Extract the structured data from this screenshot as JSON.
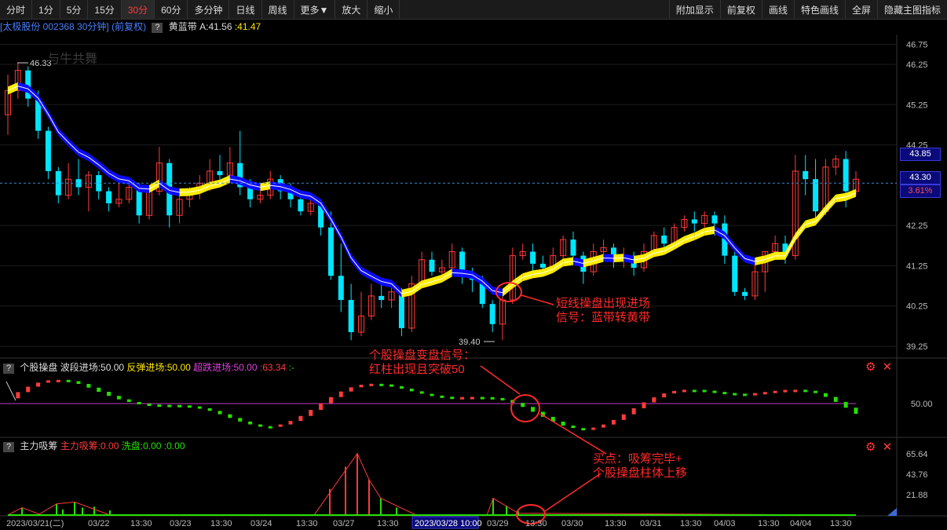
{
  "toolbar": {
    "left": [
      "分时",
      "1分",
      "5分",
      "15分",
      "30分",
      "60分",
      "多分钟",
      "日线",
      "周线",
      "更多▼",
      "放大",
      "缩小"
    ],
    "active": "30分",
    "right": [
      "附加显示",
      "前复权",
      "画线",
      "特色画线",
      "全屏",
      "隐藏主图指标"
    ]
  },
  "infobar": {
    "stock": "[太极股份 002368 30分钟]",
    "adj": "(前复权)",
    "indicator": "黄蓝带",
    "a_label": "A:41.56",
    "b_label": ":41.47"
  },
  "main_axis": [
    "46.75",
    "46.25",
    "45.25",
    "44.25",
    "42.25",
    "41.25",
    "40.25",
    "39.25"
  ],
  "price_tags": {
    "top": "43.85",
    "current": "43.30",
    "pct": "3.61%"
  },
  "high_label": "46.33",
  "low_label": "39.40",
  "watermark": "与牛共舞",
  "panel2": {
    "name": "个股操盘",
    "a": "波段进场:50.00",
    "b": "反弹进场:50.00",
    "c": "超跌进场:50.00",
    "d": ":63.34",
    "e": ":-",
    "axis": "50.00"
  },
  "panel3": {
    "name": "主力吸筹",
    "a": "主力吸筹:0.00",
    "b": "洗盘:0.00",
    "c": ":0.00",
    "axis": [
      "65.64",
      "43.76",
      "21.88"
    ]
  },
  "time_axis": [
    "2023/03/21(二)",
    "03/22",
    "13:30",
    "03/23",
    "13:30",
    "03/24",
    "13:30",
    "03/27",
    "13:30",
    "2023/03/28 10:00",
    "03/29",
    "13:30",
    "03/30",
    "13:30",
    "03/31",
    "13:30",
    "04/03",
    "13:30",
    "04/04",
    "13:30"
  ],
  "notes": {
    "n1a": "短线操盘出现进场",
    "n1b": "信号：蓝带转黄带",
    "n2a": "个股操盘变盘信号：",
    "n2b": "红柱出现且突破50",
    "n3a": "买点：吸筹完毕+",
    "n3b": "个股操盘柱体上移"
  },
  "colors": {
    "up": "#ff3b3b",
    "down": "#00e5ff",
    "blue_band": "#0a0aff",
    "yellow_band": "#ffee00",
    "green": "#25e000"
  },
  "icons": [
    "gear-icon",
    "close-icon"
  ],
  "chart_data": {
    "type": "candlestick",
    "ylim": [
      39.0,
      47.0
    ],
    "candles": [
      [
        45.0,
        45.6,
        44.5,
        46.0
      ],
      [
        45.6,
        46.1,
        45.4,
        46.3
      ],
      [
        46.1,
        45.4,
        45.2,
        46.2
      ],
      [
        45.4,
        44.6,
        44.4,
        45.6
      ],
      [
        44.6,
        43.6,
        43.4,
        44.7
      ],
      [
        43.6,
        43.0,
        42.8,
        43.7
      ],
      [
        43.0,
        43.4,
        42.9,
        43.8
      ],
      [
        43.4,
        43.2,
        43.0,
        43.9
      ],
      [
        43.2,
        43.5,
        42.6,
        43.6
      ],
      [
        43.5,
        43.1,
        42.9,
        43.6
      ],
      [
        43.1,
        42.8,
        42.6,
        43.2
      ],
      [
        42.8,
        42.9,
        42.7,
        43.3
      ],
      [
        42.9,
        43.2,
        42.8,
        43.4
      ],
      [
        43.2,
        42.5,
        42.3,
        43.3
      ],
      [
        42.5,
        43.1,
        42.4,
        43.2
      ],
      [
        43.1,
        43.8,
        43.0,
        44.2
      ],
      [
        43.8,
        42.5,
        42.2,
        43.9
      ],
      [
        42.5,
        42.9,
        42.3,
        43.0
      ],
      [
        42.9,
        43.1,
        42.7,
        43.2
      ],
      [
        43.1,
        43.3,
        42.9,
        43.5
      ],
      [
        43.3,
        43.6,
        43.1,
        43.9
      ],
      [
        43.6,
        43.5,
        43.2,
        44.0
      ],
      [
        43.5,
        43.8,
        43.3,
        44.2
      ],
      [
        43.8,
        43.2,
        43.0,
        44.6
      ],
      [
        43.2,
        42.9,
        42.7,
        43.4
      ],
      [
        42.9,
        43.0,
        42.8,
        43.1
      ],
      [
        43.0,
        43.4,
        42.9,
        43.6
      ],
      [
        43.4,
        43.1,
        42.9,
        43.5
      ],
      [
        43.1,
        42.9,
        42.7,
        43.3
      ],
      [
        42.9,
        42.6,
        42.5,
        43.0
      ],
      [
        42.6,
        42.8,
        42.5,
        43.0
      ],
      [
        42.8,
        42.2,
        42.0,
        42.9
      ],
      [
        42.2,
        41.0,
        40.9,
        42.6
      ],
      [
        41.0,
        40.4,
        40.1,
        41.8
      ],
      [
        40.4,
        39.6,
        39.4,
        40.8
      ],
      [
        39.6,
        40.0,
        39.5,
        40.6
      ],
      [
        40.0,
        40.5,
        39.9,
        40.8
      ],
      [
        40.5,
        40.4,
        40.2,
        40.9
      ],
      [
        40.4,
        40.6,
        40.2,
        40.7
      ],
      [
        40.6,
        39.7,
        39.5,
        40.7
      ],
      [
        39.7,
        40.8,
        39.6,
        41.0
      ],
      [
        40.8,
        41.4,
        40.7,
        41.6
      ],
      [
        41.4,
        41.1,
        41.0,
        41.6
      ],
      [
        41.1,
        41.2,
        40.9,
        41.4
      ],
      [
        41.2,
        41.6,
        41.1,
        41.8
      ],
      [
        41.6,
        41.0,
        40.8,
        41.7
      ],
      [
        41.0,
        40.9,
        40.6,
        41.2
      ],
      [
        40.9,
        40.3,
        40.2,
        41.0
      ],
      [
        40.3,
        39.8,
        39.6,
        40.4
      ],
      [
        39.8,
        40.4,
        39.4,
        40.5
      ],
      [
        40.4,
        41.5,
        40.3,
        41.7
      ],
      [
        41.5,
        41.6,
        41.4,
        41.8
      ],
      [
        41.6,
        41.3,
        41.1,
        41.8
      ],
      [
        41.3,
        41.2,
        41.0,
        41.5
      ],
      [
        41.2,
        41.5,
        41.1,
        41.7
      ],
      [
        41.5,
        41.9,
        41.4,
        42.0
      ],
      [
        41.9,
        41.5,
        41.3,
        42.1
      ],
      [
        41.5,
        41.1,
        40.8,
        41.6
      ],
      [
        41.1,
        41.6,
        41.0,
        41.8
      ],
      [
        41.6,
        41.7,
        41.5,
        41.9
      ],
      [
        41.7,
        41.4,
        41.2,
        41.8
      ],
      [
        41.4,
        41.5,
        41.2,
        41.7
      ],
      [
        41.5,
        41.2,
        41.0,
        41.6
      ],
      [
        41.2,
        41.6,
        41.1,
        41.8
      ],
      [
        41.6,
        42.0,
        41.5,
        42.1
      ],
      [
        42.0,
        41.8,
        41.6,
        42.2
      ],
      [
        41.8,
        42.2,
        41.7,
        42.3
      ],
      [
        42.2,
        42.4,
        42.1,
        42.5
      ],
      [
        42.4,
        42.3,
        42.1,
        42.6
      ],
      [
        42.3,
        42.5,
        42.2,
        42.6
      ],
      [
        42.5,
        42.3,
        42.0,
        42.6
      ],
      [
        42.3,
        41.5,
        41.3,
        42.5
      ],
      [
        41.5,
        40.6,
        40.5,
        41.6
      ],
      [
        40.6,
        40.5,
        40.4,
        40.7
      ],
      [
        40.5,
        41.1,
        40.4,
        41.3
      ],
      [
        41.1,
        41.6,
        40.6,
        41.6
      ],
      [
        41.6,
        41.8,
        41.4,
        42.0
      ],
      [
        41.8,
        41.5,
        41.3,
        42.0
      ],
      [
        41.5,
        43.6,
        41.4,
        44.0
      ],
      [
        43.6,
        43.4,
        43.0,
        44.0
      ],
      [
        43.4,
        42.6,
        42.3,
        43.9
      ],
      [
        42.6,
        43.7,
        42.5,
        43.9
      ],
      [
        43.7,
        43.9,
        43.5,
        44.0
      ],
      [
        43.9,
        43.1,
        42.7,
        44.1
      ],
      [
        43.1,
        43.4,
        43.0,
        43.6
      ]
    ]
  }
}
